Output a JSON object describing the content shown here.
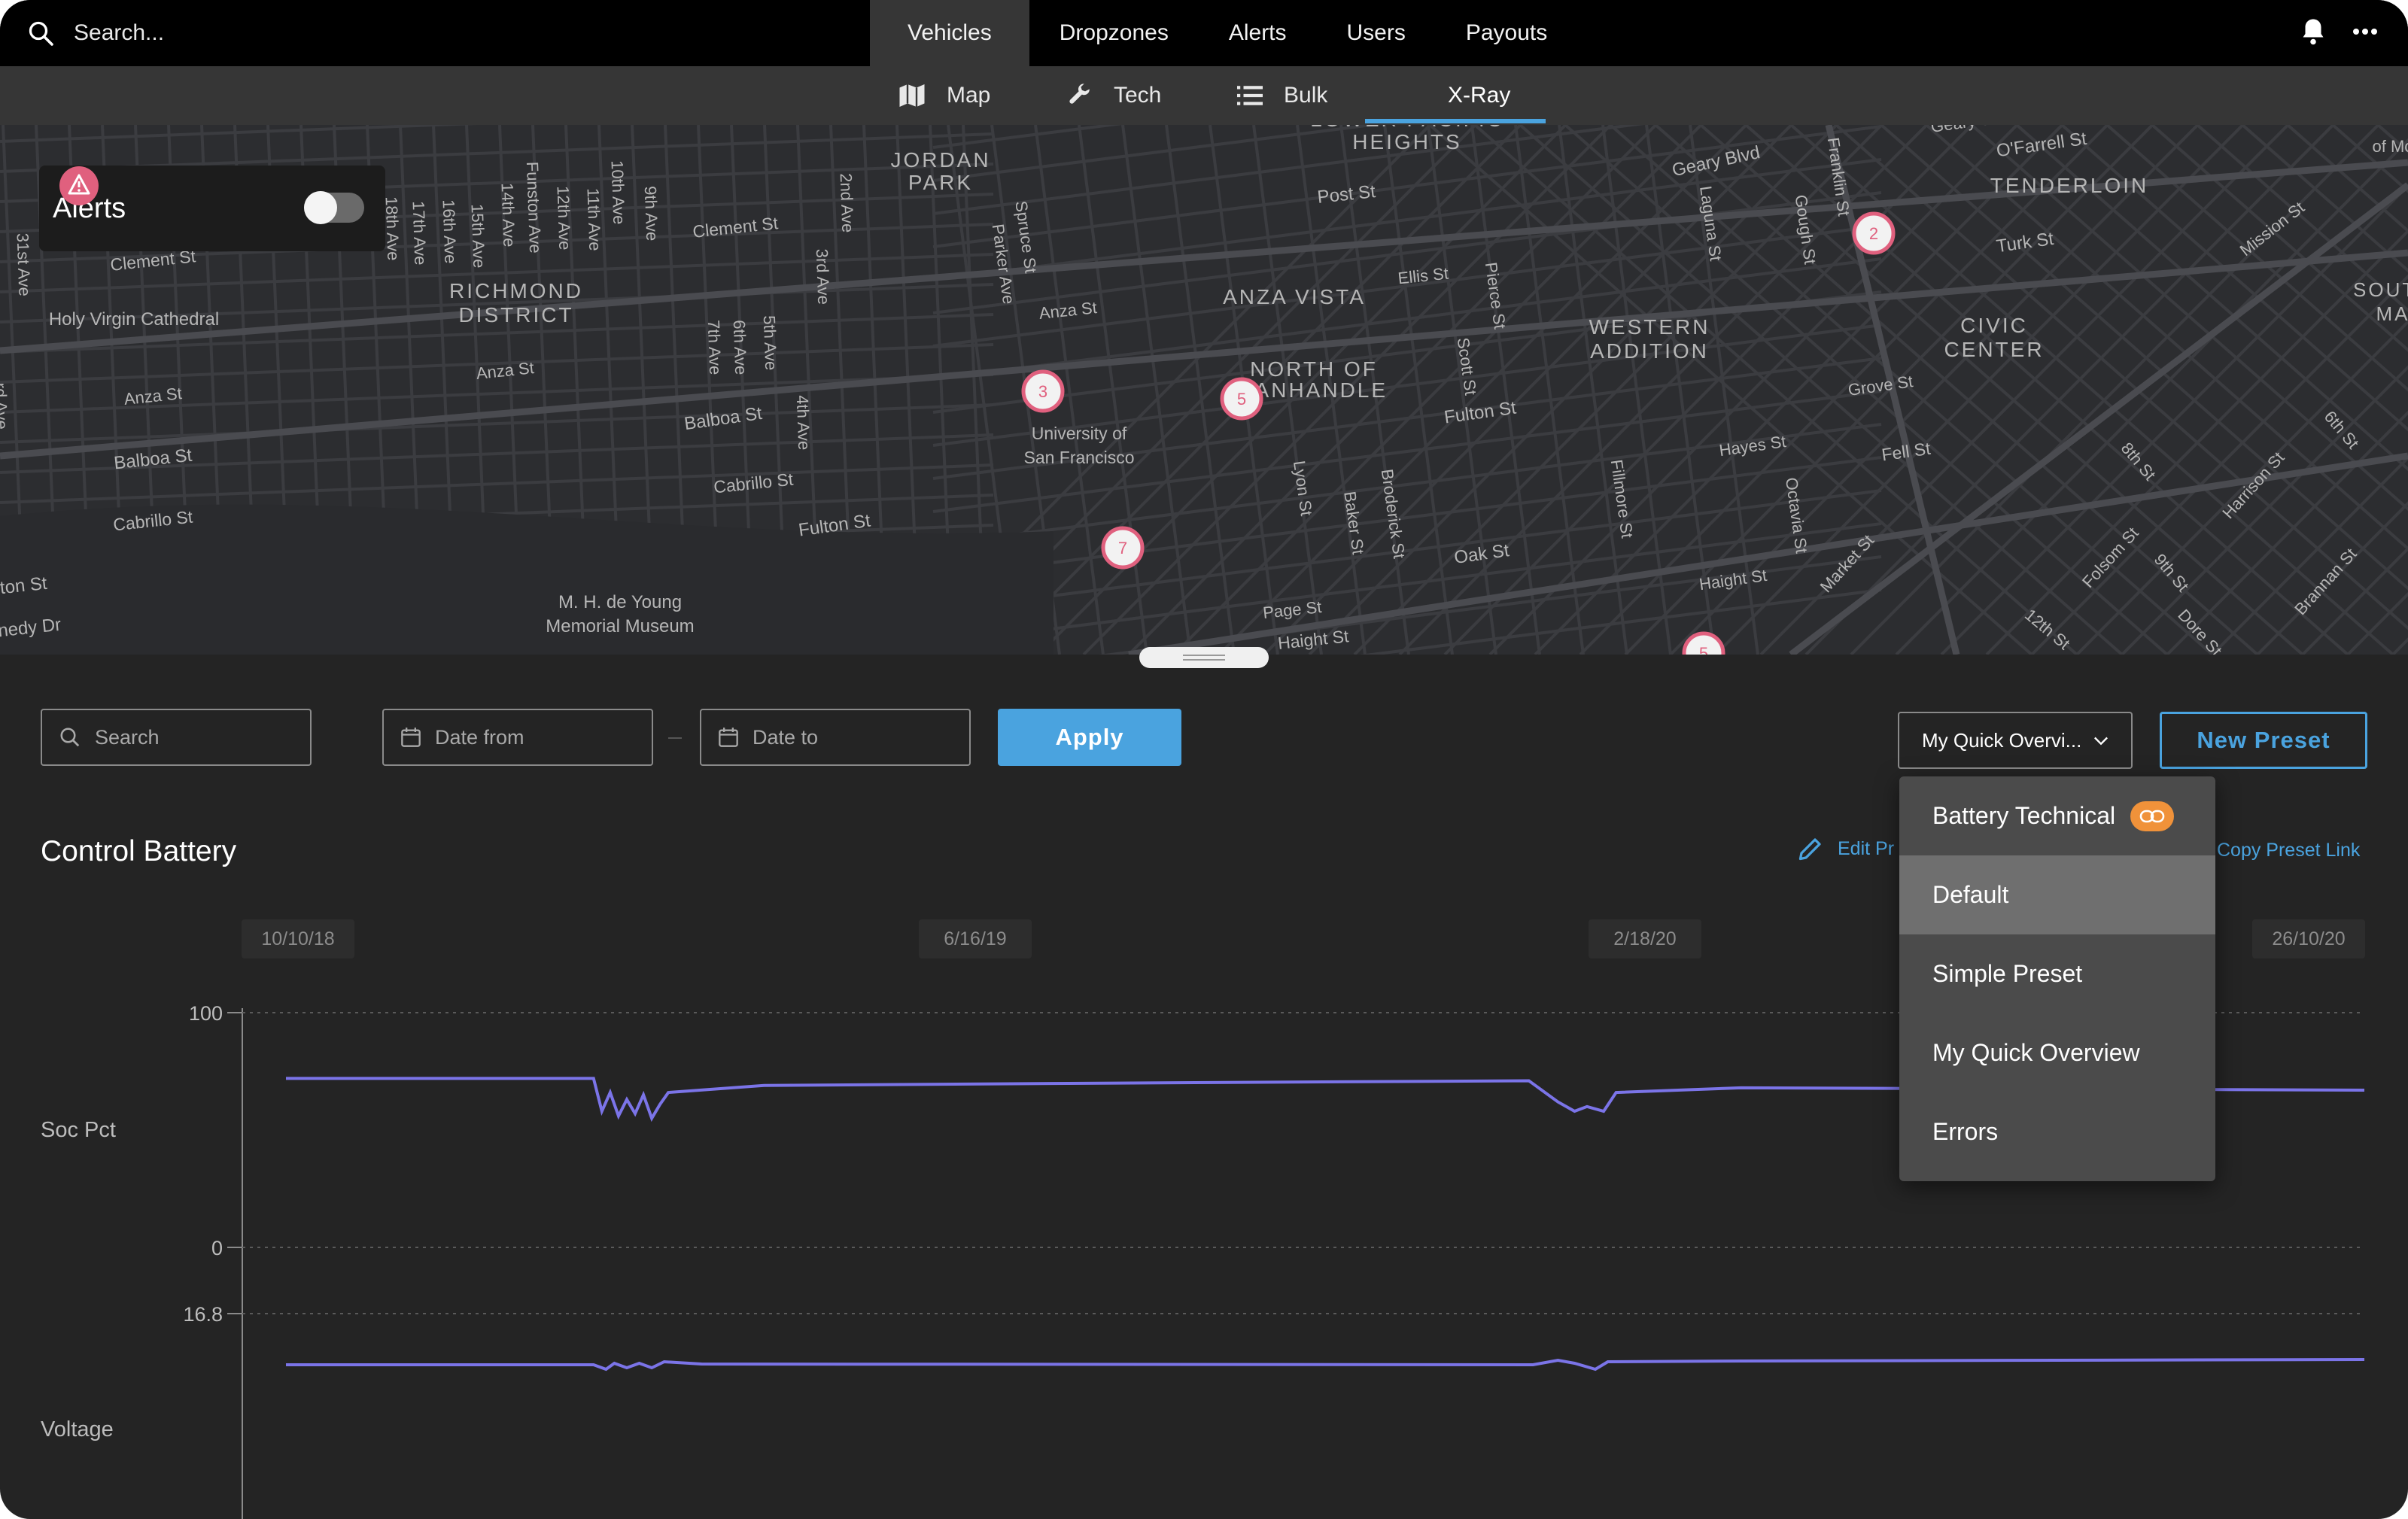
{
  "topbar": {
    "search_placeholder": "Search...",
    "tabs": [
      {
        "label": "Vehicles",
        "active": true
      },
      {
        "label": "Dropzones"
      },
      {
        "label": "Alerts"
      },
      {
        "label": "Users"
      },
      {
        "label": "Payouts"
      }
    ],
    "icons": [
      "search-icon",
      "bell-icon",
      "more-icon"
    ]
  },
  "subnav": {
    "tabs": [
      {
        "label": "Map",
        "icon": "map-icon"
      },
      {
        "label": "Tech",
        "icon": "wrench-icon"
      },
      {
        "label": "Bulk",
        "icon": "list-icon"
      },
      {
        "label": "X-Ray",
        "active": true
      }
    ]
  },
  "map": {
    "alerts_label": "Alerts",
    "alerts_toggle_on": false,
    "labels": [
      "JORDAN",
      "PARK",
      "LOWER PACIFIC",
      "HEIGHTS",
      "TENDERLOIN",
      "RICHMOND",
      "DISTRICT",
      "ANZA VISTA",
      "WESTERN",
      "ADDITION",
      "CIVIC",
      "CENTER",
      "NORTH OF",
      "PANHANDLE",
      "SOUTH",
      "MA",
      "University of",
      "San Francisco",
      "M. H. de Young",
      "Memorial Museum",
      "Holy Virgin Cathedral",
      "Geary Blvd",
      "O'Farrell St",
      "Post St",
      "Clement St",
      "Turk St",
      "Ellis St",
      "Anza St",
      "Balboa St",
      "Cabrillo St",
      "Fulton St",
      "Grove St",
      "Hayes St",
      "Fell St",
      "Oak St",
      "Haight St",
      "Page St",
      "Mission St",
      "Market St",
      "Harrison St",
      "Folsom St",
      "Brannan St",
      "8th St",
      "9th St",
      "6th St",
      "12th St",
      "Franklin St",
      "Gough St",
      "Laguna St",
      "Fillmore St",
      "Octavia St",
      "Scott St",
      "Pierce St",
      "Lyon St",
      "Baker St",
      "Broderick St",
      "Parker Ave",
      "Spruce St",
      "2nd Ave",
      "3rd Ave",
      "4th Ave",
      "5th Ave",
      "6th Ave",
      "7th Ave",
      "9th Ave",
      "10th Ave",
      "11th Ave",
      "12th Ave",
      "14th Ave",
      "15th Ave",
      "16th Ave",
      "17th Ave",
      "18th Ave",
      "31st Ave",
      "Funston Ave",
      "Geary St",
      "Dore St",
      "of Mo",
      "ton St",
      "nedy Dr",
      "rd Ave"
    ],
    "markers": [
      "2",
      "3",
      "5",
      "7",
      "5"
    ]
  },
  "toolbar": {
    "search_placeholder": "Search",
    "date_from_placeholder": "Date from",
    "date_to_placeholder": "Date to",
    "apply_label": "Apply",
    "preset_selected": "My Quick Overvi...",
    "new_preset_label": "New Preset"
  },
  "section": {
    "title": "Control Battery",
    "edit_preset_label": "Edit Pr",
    "copy_preset_link_label": "Copy Preset Link"
  },
  "preset_menu": {
    "items": [
      {
        "label": "Battery Technical",
        "badge_icon": "link-icon"
      },
      {
        "label": "Default",
        "highlighted": true
      },
      {
        "label": "Simple Preset"
      },
      {
        "label": "My Quick Overview"
      },
      {
        "label": "Errors"
      }
    ]
  },
  "chart_data": [
    {
      "type": "line",
      "ylabel": "Soc Pct",
      "ylim": [
        0,
        100
      ],
      "y_ticks": [
        "100",
        "0"
      ],
      "x_ticks": [
        "10/10/18",
        "6/16/19",
        "2/18/20",
        "26/10/20"
      ],
      "series": [
        {
          "color": "#7b74e8",
          "points": [
            [
              0,
              72
            ],
            [
              0.148,
              72
            ],
            [
              0.152,
              58
            ],
            [
              0.156,
              66
            ],
            [
              0.16,
              56
            ],
            [
              0.164,
              63
            ],
            [
              0.168,
              57
            ],
            [
              0.172,
              65
            ],
            [
              0.176,
              55
            ],
            [
              0.18,
              61
            ],
            [
              0.184,
              66
            ],
            [
              0.23,
              69
            ],
            [
              0.4,
              70
            ],
            [
              0.598,
              71
            ],
            [
              0.612,
              62
            ],
            [
              0.62,
              58
            ],
            [
              0.626,
              60
            ],
            [
              0.634,
              58
            ],
            [
              0.64,
              66
            ],
            [
              0.7,
              68
            ],
            [
              1.0,
              67
            ]
          ]
        }
      ]
    },
    {
      "type": "line",
      "ylabel": "Voltage",
      "y_ticks": [
        "16.8"
      ],
      "series": [
        {
          "color": "#7b74e8",
          "points": [
            [
              0,
              0.5
            ],
            [
              0.148,
              0.5
            ],
            [
              0.154,
              0.2
            ],
            [
              0.158,
              0.6
            ],
            [
              0.164,
              0.3
            ],
            [
              0.17,
              0.6
            ],
            [
              0.176,
              0.3
            ],
            [
              0.182,
              0.7
            ],
            [
              0.2,
              0.55
            ],
            [
              0.6,
              0.5
            ],
            [
              0.612,
              0.8
            ],
            [
              0.62,
              0.6
            ],
            [
              0.63,
              0.2
            ],
            [
              0.636,
              0.7
            ],
            [
              0.7,
              0.75
            ],
            [
              1.0,
              0.85
            ]
          ]
        }
      ]
    }
  ]
}
